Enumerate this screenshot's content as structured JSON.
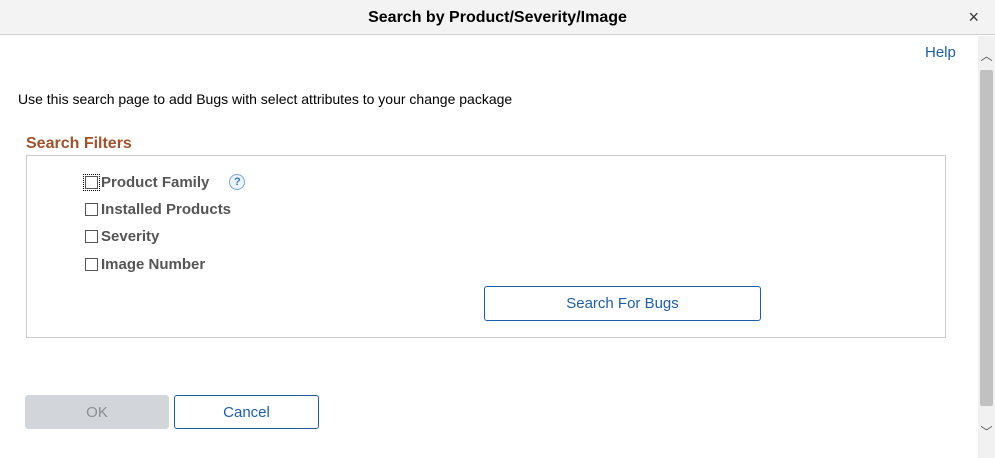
{
  "dialog": {
    "title": "Search by Product/Severity/Image",
    "close_glyph": "×"
  },
  "help": {
    "label": "Help"
  },
  "intro_text": "Use this search page to add Bugs with select attributes to your change package",
  "filters": {
    "title": "Search Filters",
    "items": [
      {
        "label": "Product Family",
        "checked": false
      },
      {
        "label": "Installed Products",
        "checked": false
      },
      {
        "label": "Severity",
        "checked": false
      },
      {
        "label": "Image Number",
        "checked": false
      }
    ],
    "info_icon_glyph": "?",
    "search_button_label": "Search For Bugs"
  },
  "actions": {
    "ok_label": "OK",
    "cancel_label": "Cancel"
  },
  "scrollbar": {
    "up_glyph": "︿",
    "down_glyph": "﹀"
  },
  "colors": {
    "link": "#1c5fa8",
    "section_title": "#a0522d",
    "disabled_button": "#d2d6db"
  }
}
